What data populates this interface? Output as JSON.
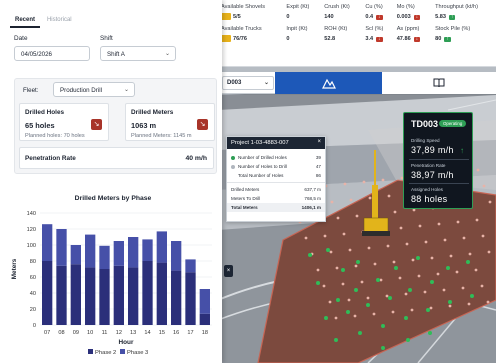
{
  "tabs": [
    {
      "label": "Recent",
      "active": true
    },
    {
      "label": "Historical",
      "active": false
    }
  ],
  "filters": {
    "date_label": "Date",
    "date_value": "04/05/2026",
    "shift_label": "Shift",
    "shift_value": "Shift A",
    "fleet_label": "Fleet:",
    "fleet_value": "Production Drill"
  },
  "cards": {
    "drilled_holes": {
      "title": "Drilled Holes",
      "value": "65 holes",
      "sub": "Planned holes: 70 holes"
    },
    "drilled_meters": {
      "title": "Drilled Meters",
      "value": "1063 m",
      "sub": "Planned Meters: 1145 m"
    },
    "penetration": {
      "title": "Penetration Rate",
      "value": "40 m/h"
    }
  },
  "chart_data": {
    "type": "bar",
    "title": "Drilled Meters by Phase",
    "xlabel": "Hour",
    "ylabel": "Meters",
    "categories": [
      "07",
      "08",
      "09",
      "10",
      "11",
      "12",
      "13",
      "14",
      "15",
      "16",
      "17",
      "18"
    ],
    "ylim": [
      0,
      140
    ],
    "yticks": [
      0,
      20,
      40,
      60,
      80,
      100,
      120,
      140
    ],
    "stacked": true,
    "series": [
      {
        "name": "Phase 2",
        "color": "#2b2f7a",
        "values": [
          80,
          74,
          76,
          72,
          70,
          74,
          72,
          80,
          78,
          68,
          66,
          14
        ]
      },
      {
        "name": "Phase 3",
        "color": "#4650a8",
        "values": [
          46,
          46,
          24,
          41,
          29,
          31,
          38,
          27,
          39,
          37,
          16,
          31
        ]
      }
    ],
    "legend_position": "bottom",
    "grid": true
  },
  "kpi": {
    "row1_headers": [
      "Available Shovels",
      "Expit (Kt)",
      "Crush (Kt)",
      "Cu (%)",
      "Mo (%)",
      "Throughput (kt/h)"
    ],
    "row1_values": [
      "5/5",
      "0",
      "140",
      "0.4",
      "0.003",
      "5.83"
    ],
    "row1_pills": [
      "",
      "",
      "",
      "red",
      "red",
      "green"
    ],
    "row2_headers": [
      "Available Trucks",
      "Inpit (Kt)",
      "ROH (Kt)",
      "Scl (%)",
      "As (ppm)",
      "Stock Pile (%)"
    ],
    "row2_values": [
      "76/76",
      "0",
      "52.8",
      "3.4",
      "47.86",
      "80"
    ],
    "row2_pills": [
      "",
      "",
      "",
      "red",
      "red",
      "green"
    ]
  },
  "toolbar": {
    "machine": "D003"
  },
  "project": {
    "title": "Project 1-03-4883-007",
    "rows": [
      {
        "label": "Number of Drilled Holes",
        "value": "39",
        "dot": "#2e9e55"
      },
      {
        "label": "Number of Holes to Drill",
        "value": "47",
        "dot": "#b0b6be"
      },
      {
        "label": "Total Number of Holes",
        "value": "86",
        "dot": ""
      }
    ],
    "meters": [
      {
        "label": "Drilled Meters",
        "value": "637,7 m"
      },
      {
        "label": "Meters To Drill",
        "value": "768,5 m"
      },
      {
        "label": "Total Meters",
        "value": "1406,1 m"
      }
    ]
  },
  "drill_card": {
    "name": "TD003",
    "status": "Operating",
    "speed_label": "Drilling Speed",
    "speed_value": "37,89 m/h",
    "pen_label": "Penetration Rate",
    "pen_value": "38,97 m/h",
    "holes_label": "Assigned Holes",
    "holes_value": "88 holes"
  },
  "colors": {
    "accent": "#1d58b8",
    "alert": "#a83429",
    "ok": "#2e9e55",
    "dark": "#10161f"
  }
}
